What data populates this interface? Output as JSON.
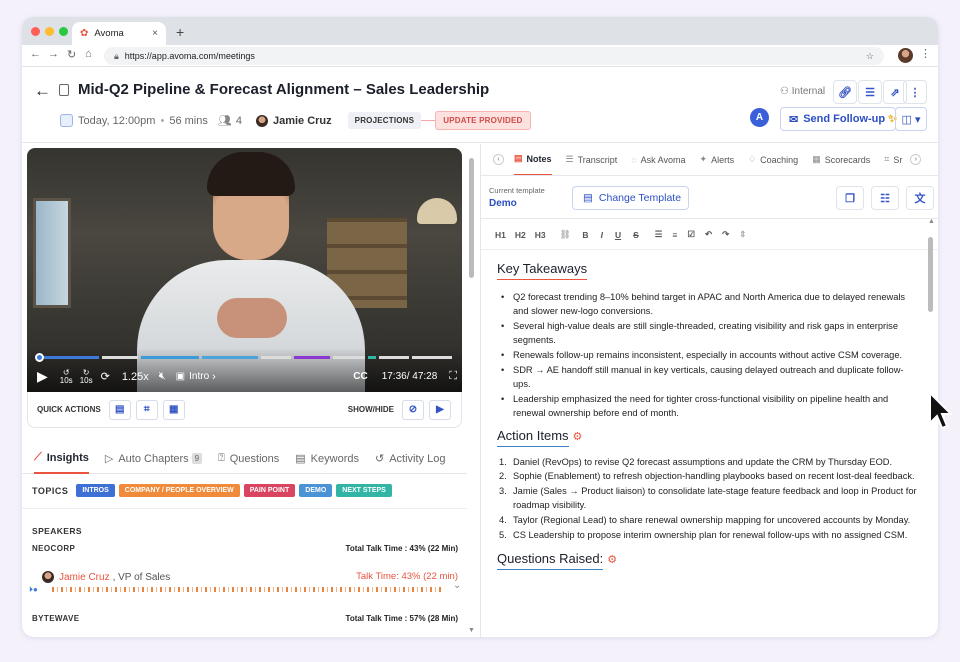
{
  "browser": {
    "tab_title": "Avoma",
    "url": "https://app.avoma.com/meetings",
    "new_tab": "+",
    "tab_close": "×"
  },
  "meeting": {
    "title": "Mid-Q2 Pipeline & Forecast Alignment – Sales Leadership",
    "date": "Today, 12:00pm",
    "duration": "56 mins",
    "attendees": "4",
    "host": "Jamie Cruz",
    "stage_chip": "PROJECTIONS",
    "status_chip": "UPDATE PROVIDED",
    "visibility": "Internal",
    "avatar_letter": "A",
    "send_followup": "Send Follow-up"
  },
  "player": {
    "speed": "1.25x",
    "chapter": "Intro",
    "time": "17:36/ 47:28",
    "skip_back": "10s",
    "skip_fwd": "10s",
    "cc": "CC",
    "quick_actions": "QUICK ACTIONS",
    "show_hide": "SHOW/HIDE",
    "progress_fraction": 0.37
  },
  "left_tabs": [
    {
      "label": "Insights"
    },
    {
      "label": "Auto Chapters",
      "badge": "9"
    },
    {
      "label": "Questions"
    },
    {
      "label": "Keywords"
    },
    {
      "label": "Activity Log"
    }
  ],
  "topics": {
    "label": "TOPICS",
    "chips": [
      {
        "label": "INTROS",
        "color": "#3d6fd4"
      },
      {
        "label": "COMPANY / PEOPLE OVERVIEW",
        "color": "#ef8b3a"
      },
      {
        "label": "PAIN POINT",
        "color": "#d94560"
      },
      {
        "label": "DEMO",
        "color": "#4a93d6"
      },
      {
        "label": "NEXT STEPS",
        "color": "#33b5a6"
      }
    ]
  },
  "speakers": {
    "label": "SPEAKERS",
    "groups": [
      {
        "company": "NEOCORP",
        "total": "Total Talk Time : 43% (22 Min)"
      },
      {
        "company": "BYTEWAVE",
        "total": "Total Talk Time : 57% (28 Min)"
      }
    ],
    "person": {
      "name": "Jamie Cruz",
      "role": ", VP of Sales",
      "talk": "Talk Time: 43% (22 min)"
    }
  },
  "right_tabs": [
    "Notes",
    "Transcript",
    "Ask Avoma",
    "Alerts",
    "Coaching",
    "Scorecards",
    "Sr"
  ],
  "template": {
    "label": "Current template",
    "value": "Demo",
    "button": "Change Template"
  },
  "editor_toolbar": [
    "H1",
    "H2",
    "H3"
  ],
  "notes": {
    "key_takeaways_title": "Key Takeaways",
    "key_takeaways": [
      "Q2 forecast trending 8–10% behind target in APAC and North America due to delayed renewals and slower new-logo conversions.",
      "Several high-value deals are still single-threaded, creating visibility and risk gaps in enterprise segments.",
      "Renewals follow-up remains inconsistent, especially in accounts without active CSM coverage.",
      "SDR → AE handoff still manual in key verticals, causing delayed outreach and duplicate follow-ups.",
      "Leadership emphasized the need for tighter cross-functional visibility on pipeline health and renewal ownership before end of month."
    ],
    "action_items_title": "Action Items",
    "action_items": [
      "Daniel (RevOps) to revise Q2 forecast assumptions and update the CRM by Thursday EOD.",
      "Sophie (Enablement) to refresh objection-handling playbooks based on recent lost-deal feedback.",
      "Jamie (Sales → Product liaison) to consolidate late-stage feature feedback and loop in Product for roadmap visibility.",
      "Taylor (Regional Lead) to share renewal ownership mapping for uncovered accounts by Monday.",
      "CS Leadership to propose interim ownership plan for renewal follow-ups with no assigned CSM."
    ],
    "questions_title": "Questions Raised:"
  }
}
